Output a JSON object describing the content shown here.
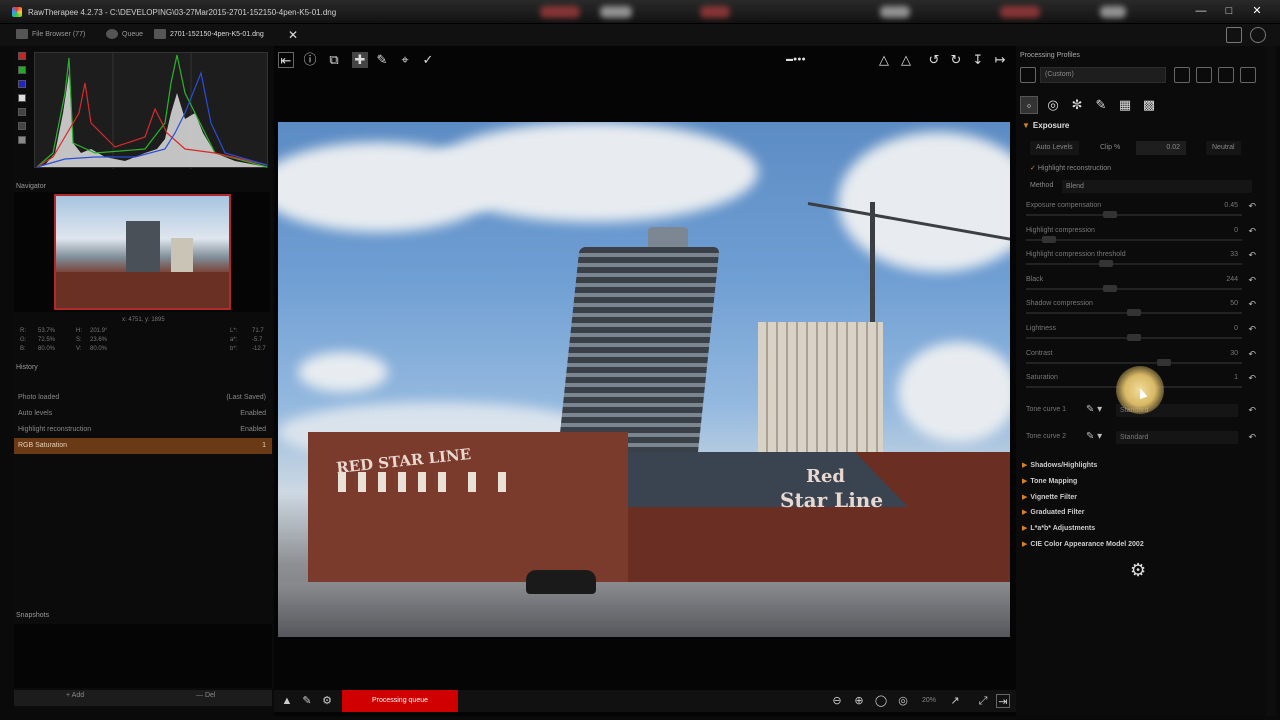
{
  "window": {
    "title": "RawTherapee 4.2.73 - C:\\DEVELOPING\\03-27Mar2015-2701-152150-4pen-K5-01.dng"
  },
  "tabs": [
    {
      "label": "File Browser (77)"
    },
    {
      "label": "Queue"
    },
    {
      "label": "2701-152150-4pen-K5-01.dng"
    }
  ],
  "left": {
    "navigator_label": "Navigator",
    "coords": "x: 4751, y: 1895",
    "readout": [
      [
        "R:",
        "53.7%",
        "H:",
        "201.9°",
        "L*:",
        "71.7"
      ],
      [
        "G:",
        "72.5%",
        "S:",
        "23.6%",
        "a*:",
        "-5.7"
      ],
      [
        "B:",
        "80.0%",
        "V:",
        "80.0%",
        "b*:",
        "-12.7"
      ]
    ],
    "history_label": "History",
    "history": [
      {
        "label": "Photo loaded",
        "value": "(Last Saved)"
      },
      {
        "label": "Auto levels",
        "value": "Enabled"
      },
      {
        "label": "Highlight reconstruction",
        "value": "Enabled"
      },
      {
        "label": "RGB Saturation",
        "value": "1"
      }
    ],
    "snapshots_label": "Snapshots",
    "add_label": "Add",
    "del_label": "Del"
  },
  "photo": {
    "sign1": "RED STAR LINE",
    "sign2a": "Red",
    "sign2b": "Star Line"
  },
  "bottom": {
    "red_button": "Processing queue",
    "zoom": "20%"
  },
  "right": {
    "title": "Processing Profiles",
    "profile": "(Custom)",
    "exposure": "Exposure",
    "auto_levels": "Auto Levels",
    "clip_label": "Clip %",
    "clip_value": "0.02",
    "neutral": "Neutral",
    "highlight_recon": "Highlight reconstruction",
    "method_label": "Method",
    "method_value": "Blend",
    "sliders": [
      {
        "label": "Exposure compensation",
        "value": "0.45",
        "pos": 0.38
      },
      {
        "label": "Highlight compression",
        "value": "0",
        "pos": 0.08
      },
      {
        "label": "Highlight compression threshold",
        "value": "33",
        "pos": 0.36
      },
      {
        "label": "Black",
        "value": "244",
        "pos": 0.38
      },
      {
        "label": "Shadow compression",
        "value": "50",
        "pos": 0.5
      },
      {
        "label": "Lightness",
        "value": "0",
        "pos": 0.5
      },
      {
        "label": "Contrast",
        "value": "30",
        "pos": 0.65
      },
      {
        "label": "Saturation",
        "value": "1",
        "pos": 0.5
      }
    ],
    "curves": [
      {
        "label": "Tone curve 1",
        "value": "Standard"
      },
      {
        "label": "Tone curve 2",
        "value": "Standard"
      }
    ],
    "sections": [
      "Shadows/Highlights",
      "Tone Mapping",
      "Vignette Filter",
      "Graduated Filter",
      "L*a*b* Adjustments",
      "CIE Color Appearance Model 2002"
    ]
  }
}
